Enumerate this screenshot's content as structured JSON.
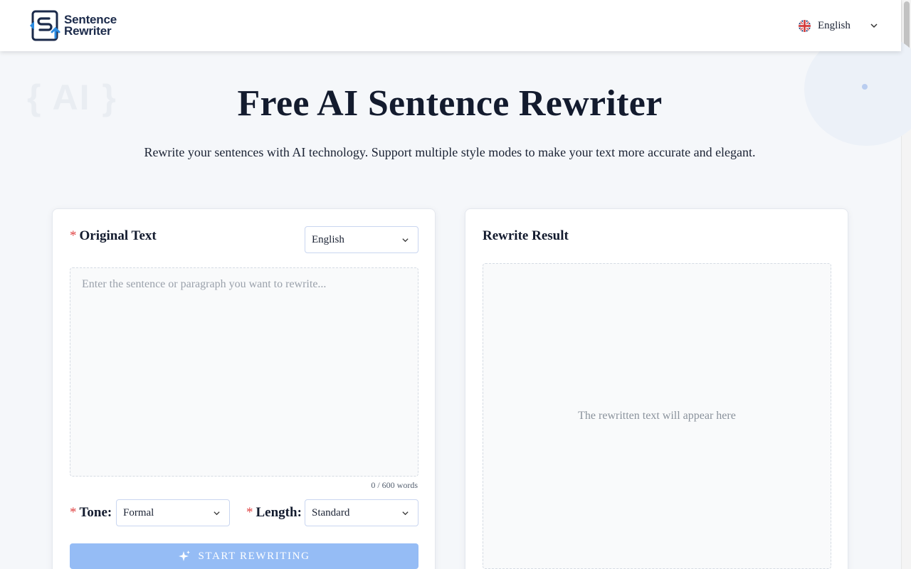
{
  "header": {
    "logo": {
      "line1": "Sentence",
      "line2": "Rewriter"
    },
    "language": {
      "label": "English",
      "icon": "uk-flag-icon"
    }
  },
  "decorations": {
    "ai_text": "{ AI }"
  },
  "hero": {
    "title": "Free AI Sentence Rewriter",
    "subtitle": "Rewrite your sentences with AI technology. Support multiple style modes to make your text more accurate and elegant."
  },
  "input_panel": {
    "required_mark": "*",
    "title": "Original Text",
    "source_language": "English",
    "textarea_placeholder": "Enter the sentence or paragraph you want to rewrite...",
    "word_count": "0 / 600 words",
    "tone": {
      "label": "Tone:",
      "value": "Formal"
    },
    "length": {
      "label": "Length:",
      "value": "Standard"
    },
    "start_button": "Start Rewriting"
  },
  "result_panel": {
    "title": "Rewrite Result",
    "placeholder": "The rewritten text will appear here"
  },
  "colors": {
    "accent": "#95bcf5",
    "required": "#e04848",
    "brand_dark": "#1b2a4a",
    "brand_blue": "#2c8be0"
  }
}
